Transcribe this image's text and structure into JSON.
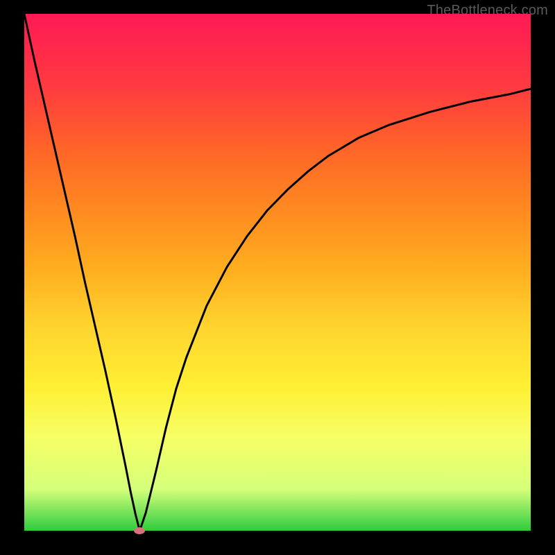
{
  "watermark": "TheBottleneck.com",
  "marker_color": "#d9717a",
  "chart_data": {
    "type": "line",
    "title": "",
    "xlabel": "",
    "ylabel": "",
    "xlim": [
      0,
      100
    ],
    "ylim": [
      0,
      100
    ],
    "x": [
      0,
      2,
      4,
      6,
      8,
      10,
      12,
      14,
      16,
      18,
      20,
      21,
      22,
      22.8,
      24,
      26,
      28,
      30,
      32,
      36,
      40,
      44,
      48,
      52,
      56,
      60,
      66,
      72,
      80,
      88,
      96,
      100
    ],
    "values": [
      100,
      91,
      82.5,
      74,
      65.5,
      57,
      48,
      39.5,
      31,
      22,
      12.5,
      7.5,
      3,
      0,
      3.5,
      11.5,
      20,
      27.5,
      33.5,
      43.5,
      51,
      57,
      62,
      66,
      69.5,
      72.5,
      76,
      78.5,
      81,
      83,
      84.5,
      85.5
    ],
    "marker": {
      "x": 22.8,
      "y": 0
    },
    "gradient_stops": [
      {
        "pos": 0,
        "color": "#2ecc40"
      },
      {
        "pos": 0.18,
        "color": "#f6ff66"
      },
      {
        "pos": 0.5,
        "color": "#ffb020"
      },
      {
        "pos": 1.0,
        "color": "#ff1a55"
      }
    ]
  }
}
